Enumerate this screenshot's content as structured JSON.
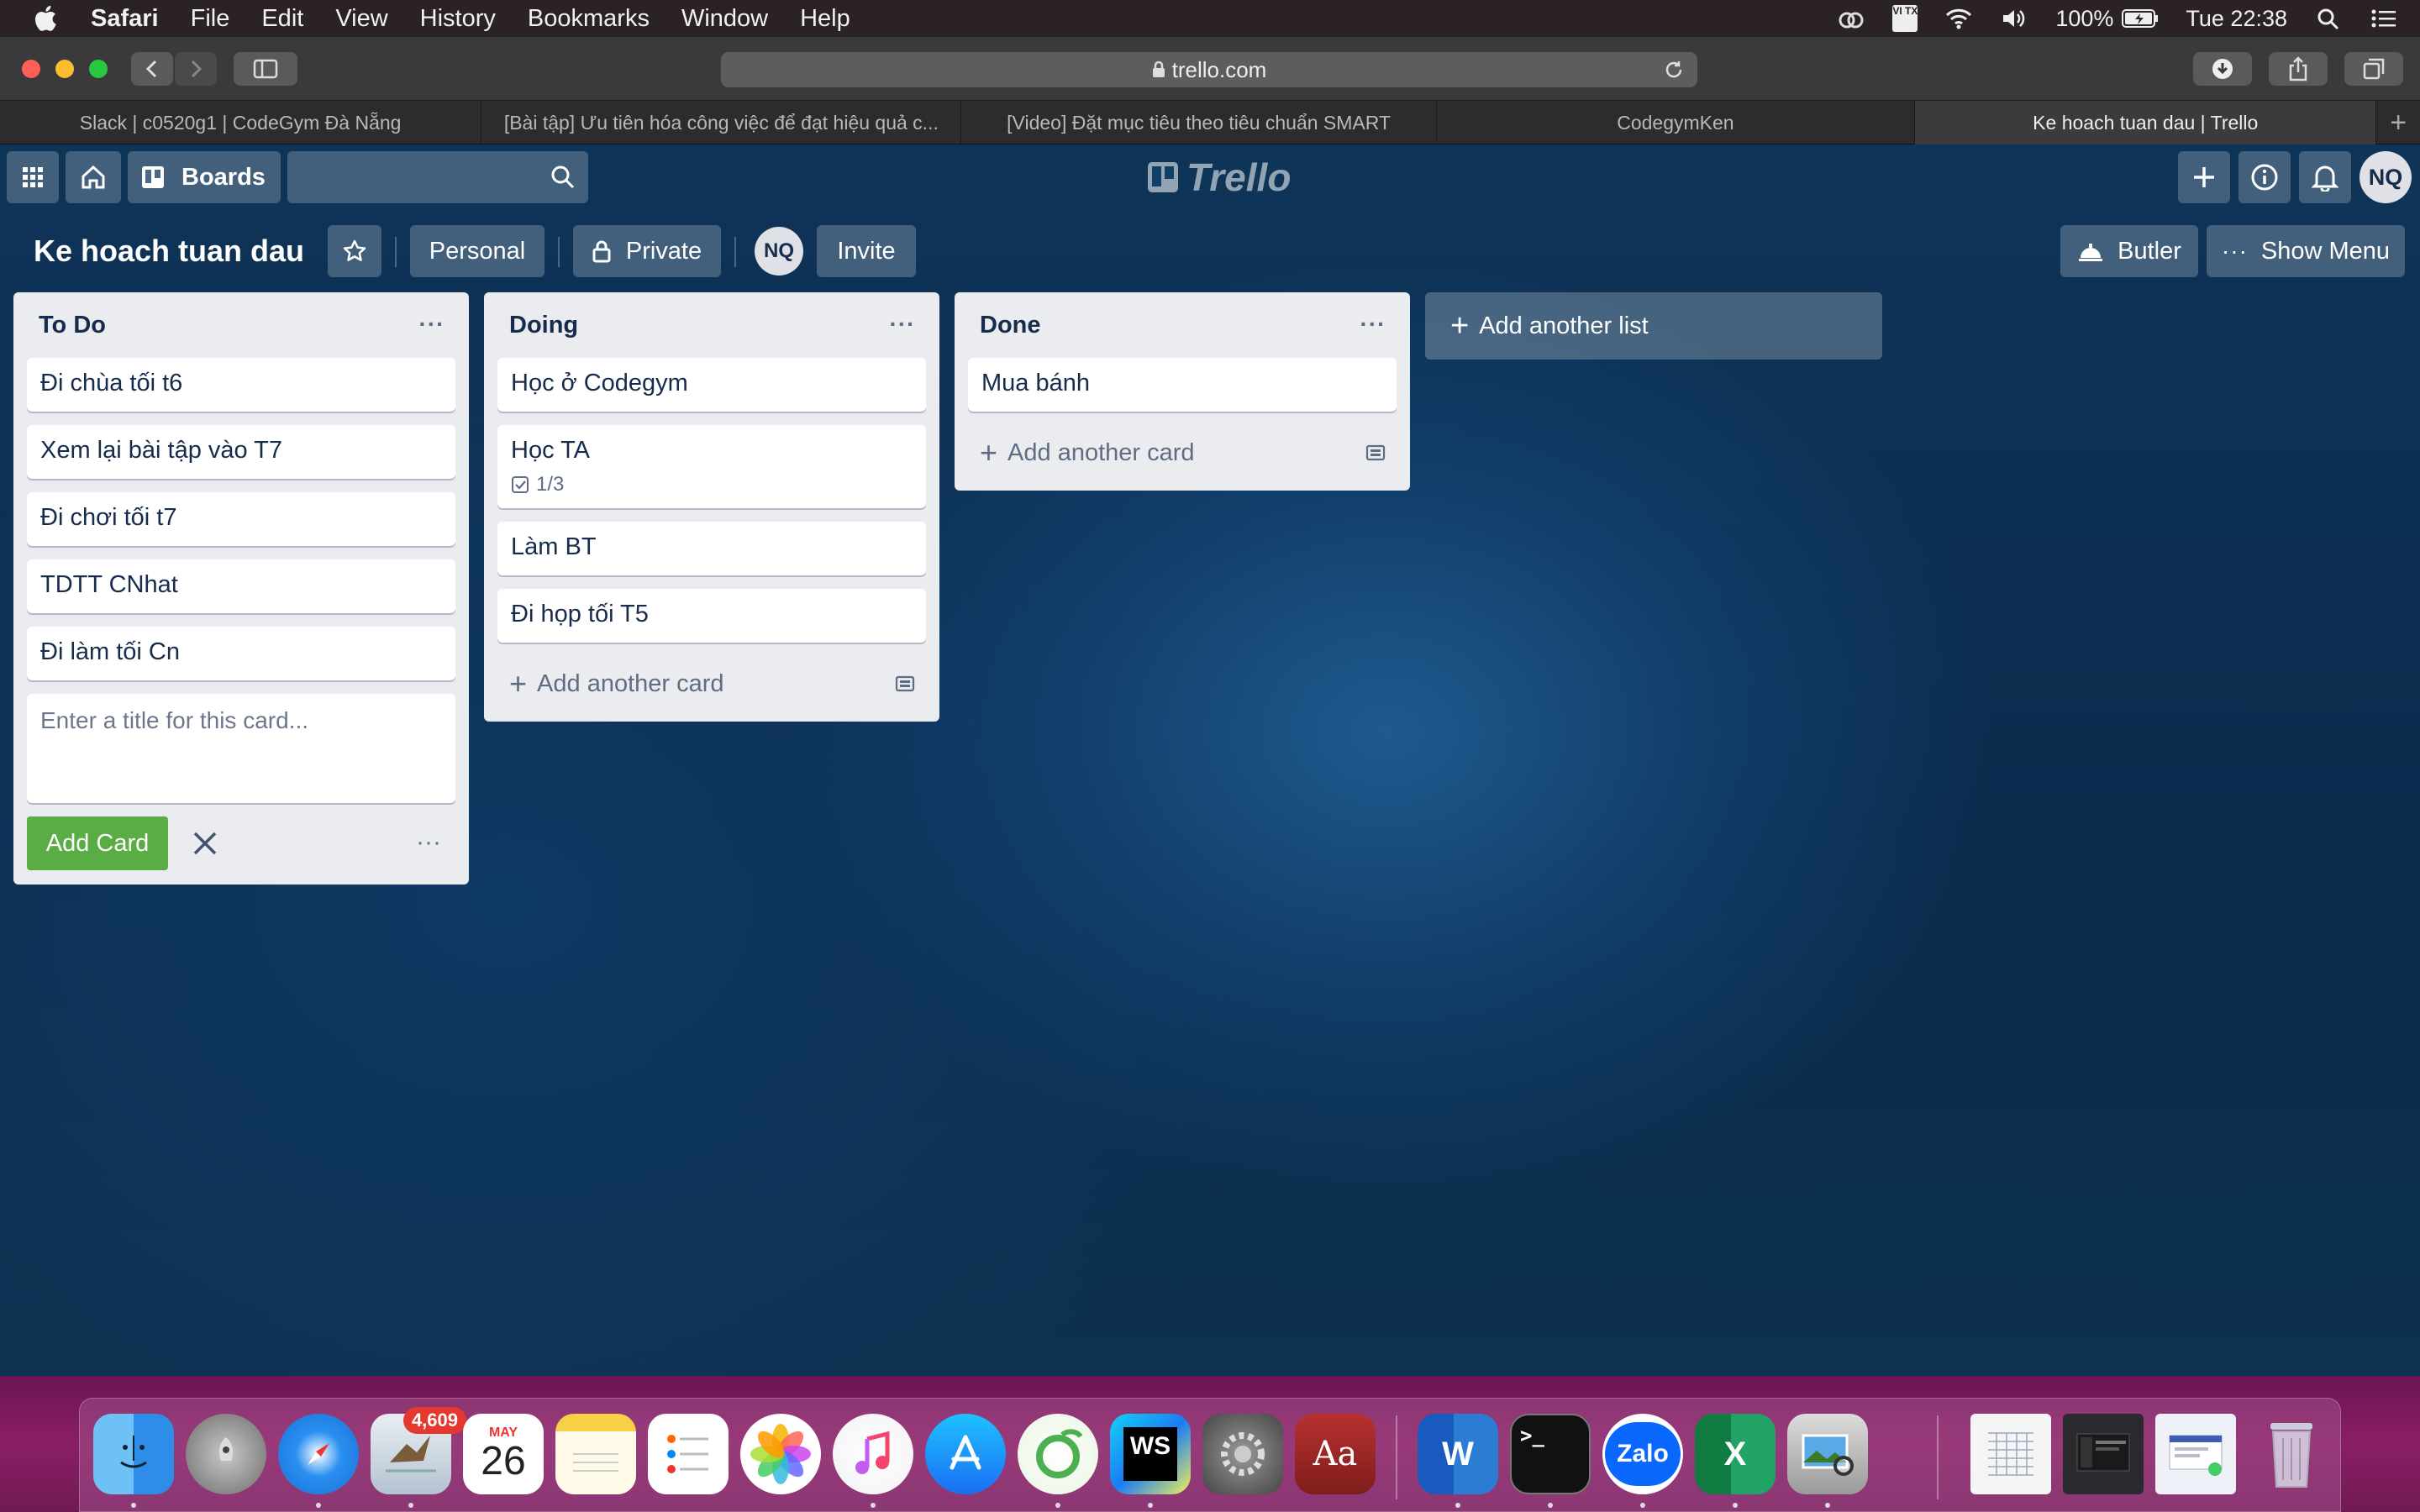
{
  "menubar": {
    "app": "Safari",
    "items": [
      "File",
      "Edit",
      "View",
      "History",
      "Bookmarks",
      "Window",
      "Help"
    ],
    "battery": "100%",
    "clock": "Tue 22:38",
    "input_source": "VI TX"
  },
  "browser": {
    "url": "trello.com",
    "tabs": [
      {
        "label": "Slack | c0520g1 | CodeGym Đà Nẵng"
      },
      {
        "label": "[Bài tập] Ưu tiên hóa công việc để đạt hiệu quả c..."
      },
      {
        "label": "[Video] Đặt mục tiêu theo tiêu chuẩn SMART"
      },
      {
        "label": "CodegymKen"
      },
      {
        "label": "Ke hoach tuan dau | Trello"
      }
    ]
  },
  "trello": {
    "header": {
      "boards_label": "Boards",
      "logo_text": "Trello",
      "user_initials": "NQ"
    },
    "board": {
      "title": "Ke hoach tuan dau",
      "team_label": "Personal",
      "visibility_label": "Private",
      "member_initials": "NQ",
      "invite_label": "Invite",
      "butler_label": "Butler",
      "show_menu_label": "Show Menu"
    },
    "lists": [
      {
        "title": "To Do",
        "cards": [
          {
            "title": "Đi chùa tối t6"
          },
          {
            "title": "Xem lại bài tập vào T7"
          },
          {
            "title": "Đi chơi tối t7"
          },
          {
            "title": "TDTT CNhat"
          },
          {
            "title": "Đi làm tối Cn"
          }
        ],
        "composer_placeholder": "Enter a title for this card...",
        "add_button_label": "Add Card"
      },
      {
        "title": "Doing",
        "cards": [
          {
            "title": "Học ở Codegym"
          },
          {
            "title": "Học TA",
            "checklist": "1/3"
          },
          {
            "title": "Làm BT"
          },
          {
            "title": "Đi họp tối T5"
          }
        ],
        "add_card_label": "Add another card"
      },
      {
        "title": "Done",
        "cards": [
          {
            "title": "Mua bánh"
          }
        ],
        "add_card_label": "Add another card"
      }
    ],
    "add_list_label": "Add another list"
  },
  "dock": {
    "mail_badge": "4,609",
    "calendar_month": "MAY",
    "calendar_day": "26",
    "apps": [
      "finder-icon",
      "launchpad-icon",
      "safari-icon",
      "mail-icon",
      "calendar-icon",
      "notes-icon",
      "reminders-icon",
      "photos-icon",
      "music-icon",
      "app-store-icon",
      "coccoc-icon",
      "webstorm-icon",
      "system-preferences-icon",
      "dictionary-icon",
      "word-icon",
      "terminal-icon",
      "zalo-icon",
      "excel-icon",
      "preview-icon"
    ],
    "word_label": "W",
    "excel_label": "X",
    "zalo_label": "Zalo",
    "webstorm_label": "WS",
    "dictionary_label": "Aa"
  }
}
